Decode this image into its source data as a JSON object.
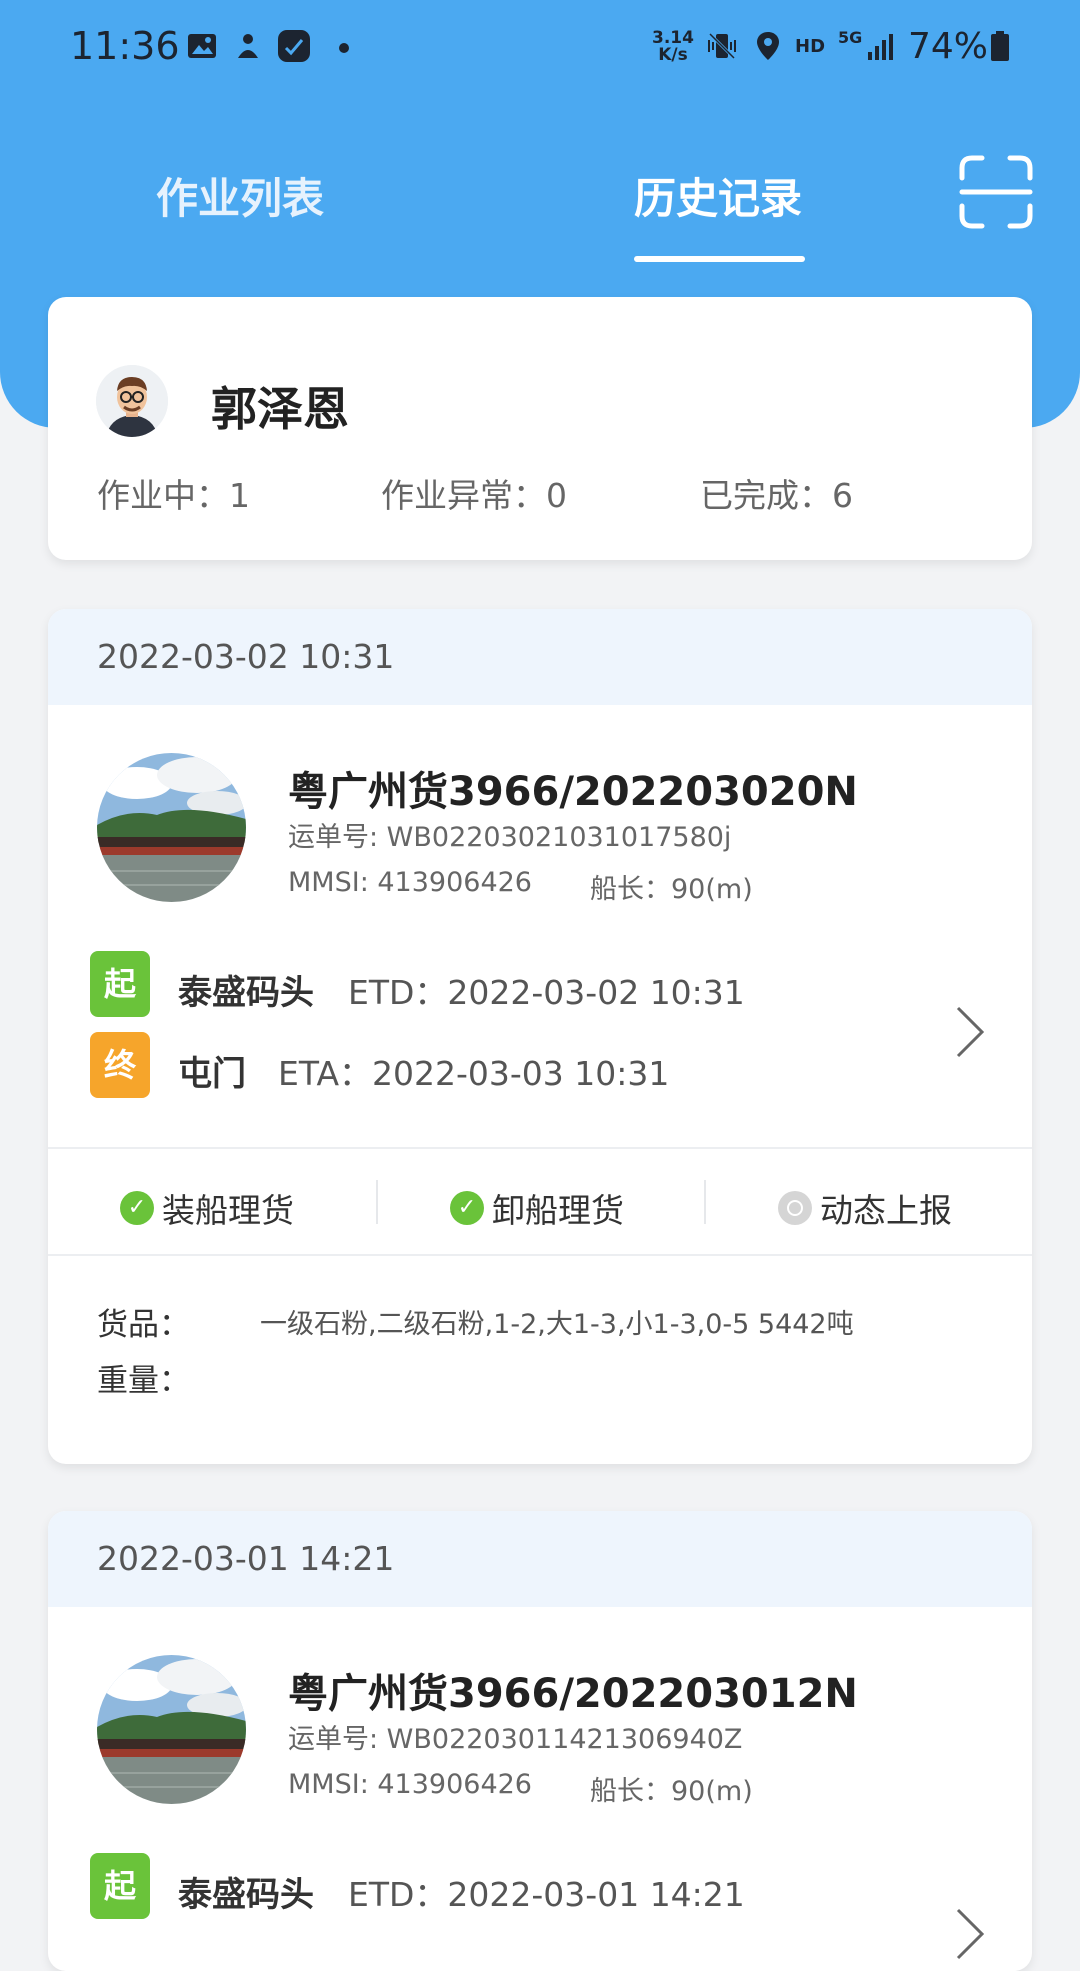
{
  "status_bar": {
    "time": "11:36",
    "net_speed_value": "3.14",
    "net_speed_unit": "K/s",
    "hd": "HD",
    "network": "5G",
    "battery": "74%"
  },
  "tabs": [
    {
      "label": "作业列表",
      "active": false
    },
    {
      "label": "历史记录",
      "active": true
    }
  ],
  "profile": {
    "name": "郭泽恩",
    "stats": [
      {
        "label": "作业中：1"
      },
      {
        "label": "作业异常：0"
      },
      {
        "label": "已完成：6"
      }
    ]
  },
  "records": [
    {
      "date": "2022-03-02 10:31",
      "ship_title": "粤广州货3966/202203020N",
      "waybill": "运单号: WB02203021031017580j",
      "mmsi": "MMSI: 413906426",
      "length": "船长：90(m)",
      "start_tag": "起",
      "start_port": "泰盛码头",
      "etd": "ETD：2022-03-02 10:31",
      "end_tag": "终",
      "end_port": "屯门",
      "eta": "ETA：2022-03-03 10:31",
      "actions": [
        {
          "label": "装船理货",
          "done": true
        },
        {
          "label": "卸船理货",
          "done": true
        },
        {
          "label": "动态上报",
          "done": false
        }
      ],
      "goods_label": "货品：",
      "goods_value": "一级石粉,二级石粉,1-2,大1-3,小1-3,0-5  5442吨",
      "weight_label": "重量："
    },
    {
      "date": "2022-03-01 14:21",
      "ship_title": "粤广州货3966/202203012N",
      "waybill": "运单号: WB02203011421306940Z",
      "mmsi": "MMSI: 413906426",
      "length": "船长：90(m)",
      "start_tag": "起",
      "start_port": "泰盛码头",
      "etd": "ETD：2022-03-01 14:21"
    }
  ]
}
